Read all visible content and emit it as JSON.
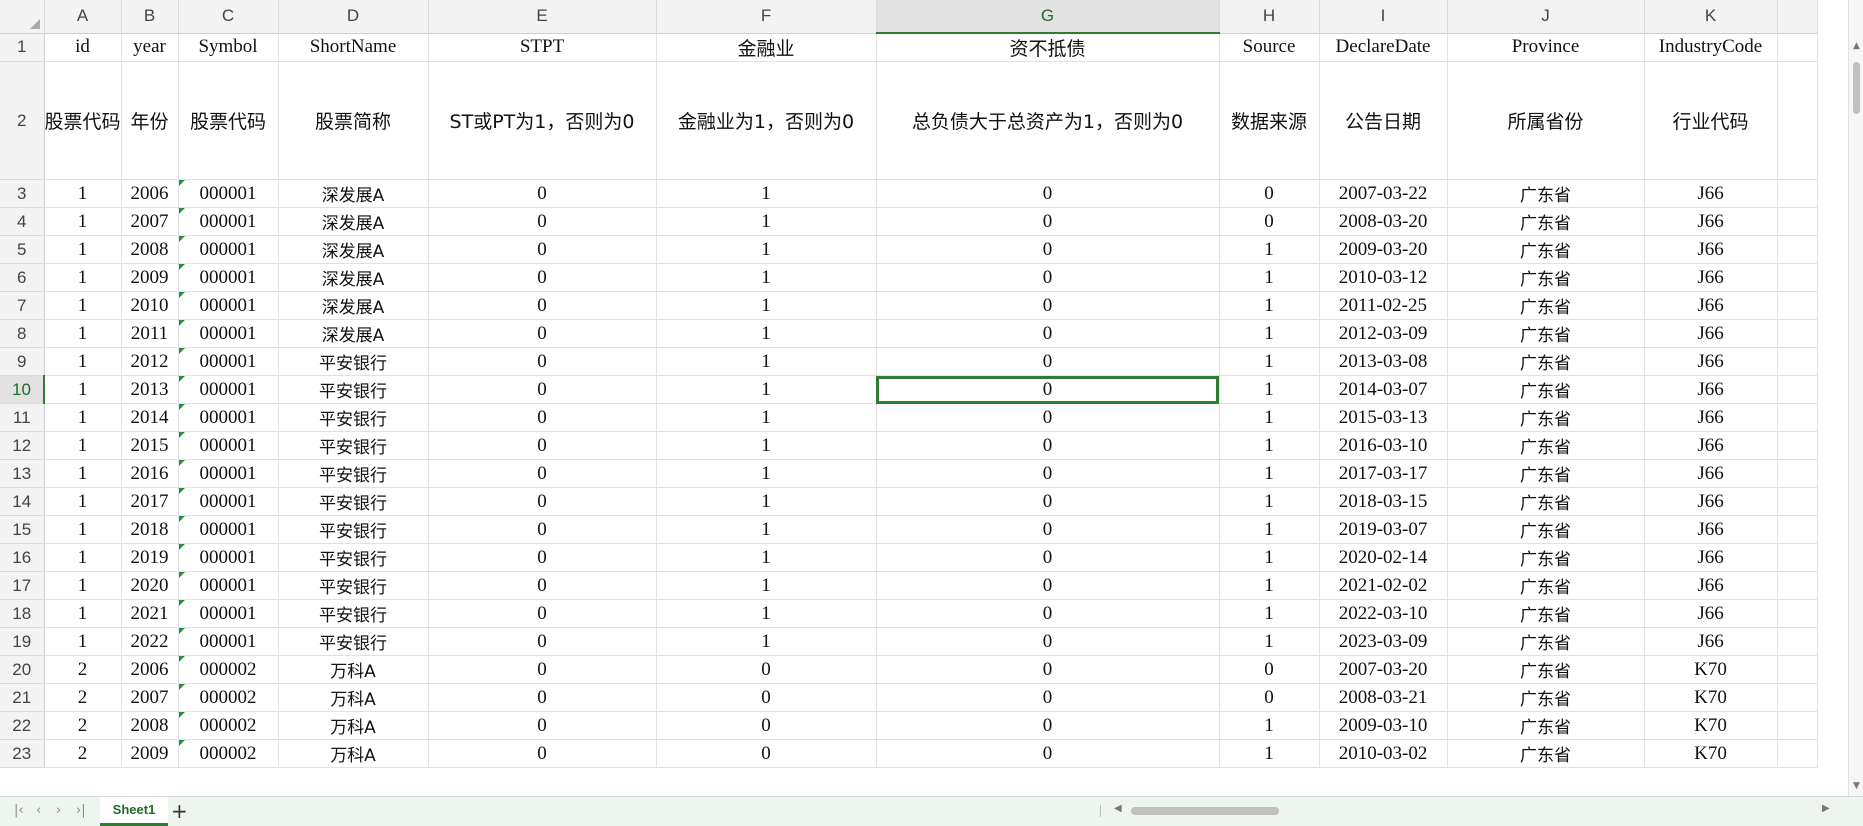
{
  "app": {
    "sheet_tab": "Sheet1",
    "add_sheet_symbol": "+"
  },
  "columns": [
    {
      "letter": "A",
      "width": 50
    },
    {
      "letter": "B",
      "width": 57
    },
    {
      "letter": "C",
      "width": 100
    },
    {
      "letter": "D",
      "width": 150
    },
    {
      "letter": "E",
      "width": 228
    },
    {
      "letter": "F",
      "width": 220
    },
    {
      "letter": "G",
      "width": 343
    },
    {
      "letter": "H",
      "width": 100
    },
    {
      "letter": "I",
      "width": 128
    },
    {
      "letter": "J",
      "width": 197
    },
    {
      "letter": "K",
      "width": 133
    }
  ],
  "selected_cell": {
    "col": "G",
    "row": 10
  },
  "header_row1": [
    "id",
    "year",
    "Symbol",
    "ShortName",
    "STPT",
    "金融业",
    "资不抵债",
    "Source",
    "DeclareDate",
    "Province",
    "IndustryCode"
  ],
  "header_row2": [
    "股票代码",
    "年份",
    "股票代码",
    "股票简称",
    "ST或PT为1，否则为0",
    "金融业为1，否则为0",
    "总负债大于总资产为1，否则为0",
    "数据来源",
    "公告日期",
    "所属省份",
    "行业代码"
  ],
  "rows": [
    [
      "1",
      "2006",
      "000001",
      "深发展A",
      "0",
      "1",
      "0",
      "0",
      "2007-03-22",
      "广东省",
      "J66"
    ],
    [
      "1",
      "2007",
      "000001",
      "深发展A",
      "0",
      "1",
      "0",
      "0",
      "2008-03-20",
      "广东省",
      "J66"
    ],
    [
      "1",
      "2008",
      "000001",
      "深发展A",
      "0",
      "1",
      "0",
      "1",
      "2009-03-20",
      "广东省",
      "J66"
    ],
    [
      "1",
      "2009",
      "000001",
      "深发展A",
      "0",
      "1",
      "0",
      "1",
      "2010-03-12",
      "广东省",
      "J66"
    ],
    [
      "1",
      "2010",
      "000001",
      "深发展A",
      "0",
      "1",
      "0",
      "1",
      "2011-02-25",
      "广东省",
      "J66"
    ],
    [
      "1",
      "2011",
      "000001",
      "深发展A",
      "0",
      "1",
      "0",
      "1",
      "2012-03-09",
      "广东省",
      "J66"
    ],
    [
      "1",
      "2012",
      "000001",
      "平安银行",
      "0",
      "1",
      "0",
      "1",
      "2013-03-08",
      "广东省",
      "J66"
    ],
    [
      "1",
      "2013",
      "000001",
      "平安银行",
      "0",
      "1",
      "0",
      "1",
      "2014-03-07",
      "广东省",
      "J66"
    ],
    [
      "1",
      "2014",
      "000001",
      "平安银行",
      "0",
      "1",
      "0",
      "1",
      "2015-03-13",
      "广东省",
      "J66"
    ],
    [
      "1",
      "2015",
      "000001",
      "平安银行",
      "0",
      "1",
      "0",
      "1",
      "2016-03-10",
      "广东省",
      "J66"
    ],
    [
      "1",
      "2016",
      "000001",
      "平安银行",
      "0",
      "1",
      "0",
      "1",
      "2017-03-17",
      "广东省",
      "J66"
    ],
    [
      "1",
      "2017",
      "000001",
      "平安银行",
      "0",
      "1",
      "0",
      "1",
      "2018-03-15",
      "广东省",
      "J66"
    ],
    [
      "1",
      "2018",
      "000001",
      "平安银行",
      "0",
      "1",
      "0",
      "1",
      "2019-03-07",
      "广东省",
      "J66"
    ],
    [
      "1",
      "2019",
      "000001",
      "平安银行",
      "0",
      "1",
      "0",
      "1",
      "2020-02-14",
      "广东省",
      "J66"
    ],
    [
      "1",
      "2020",
      "000001",
      "平安银行",
      "0",
      "1",
      "0",
      "1",
      "2021-02-02",
      "广东省",
      "J66"
    ],
    [
      "1",
      "2021",
      "000001",
      "平安银行",
      "0",
      "1",
      "0",
      "1",
      "2022-03-10",
      "广东省",
      "J66"
    ],
    [
      "1",
      "2022",
      "000001",
      "平安银行",
      "0",
      "1",
      "0",
      "1",
      "2023-03-09",
      "广东省",
      "J66"
    ],
    [
      "2",
      "2006",
      "000002",
      "万科A",
      "0",
      "0",
      "0",
      "0",
      "2007-03-20",
      "广东省",
      "K70"
    ],
    [
      "2",
      "2007",
      "000002",
      "万科A",
      "0",
      "0",
      "0",
      "0",
      "2008-03-21",
      "广东省",
      "K70"
    ],
    [
      "2",
      "2008",
      "000002",
      "万科A",
      "0",
      "0",
      "0",
      "1",
      "2009-03-10",
      "广东省",
      "K70"
    ],
    [
      "2",
      "2009",
      "000002",
      "万科A",
      "0",
      "0",
      "0",
      "1",
      "2010-03-02",
      "广东省",
      "K70"
    ]
  ]
}
